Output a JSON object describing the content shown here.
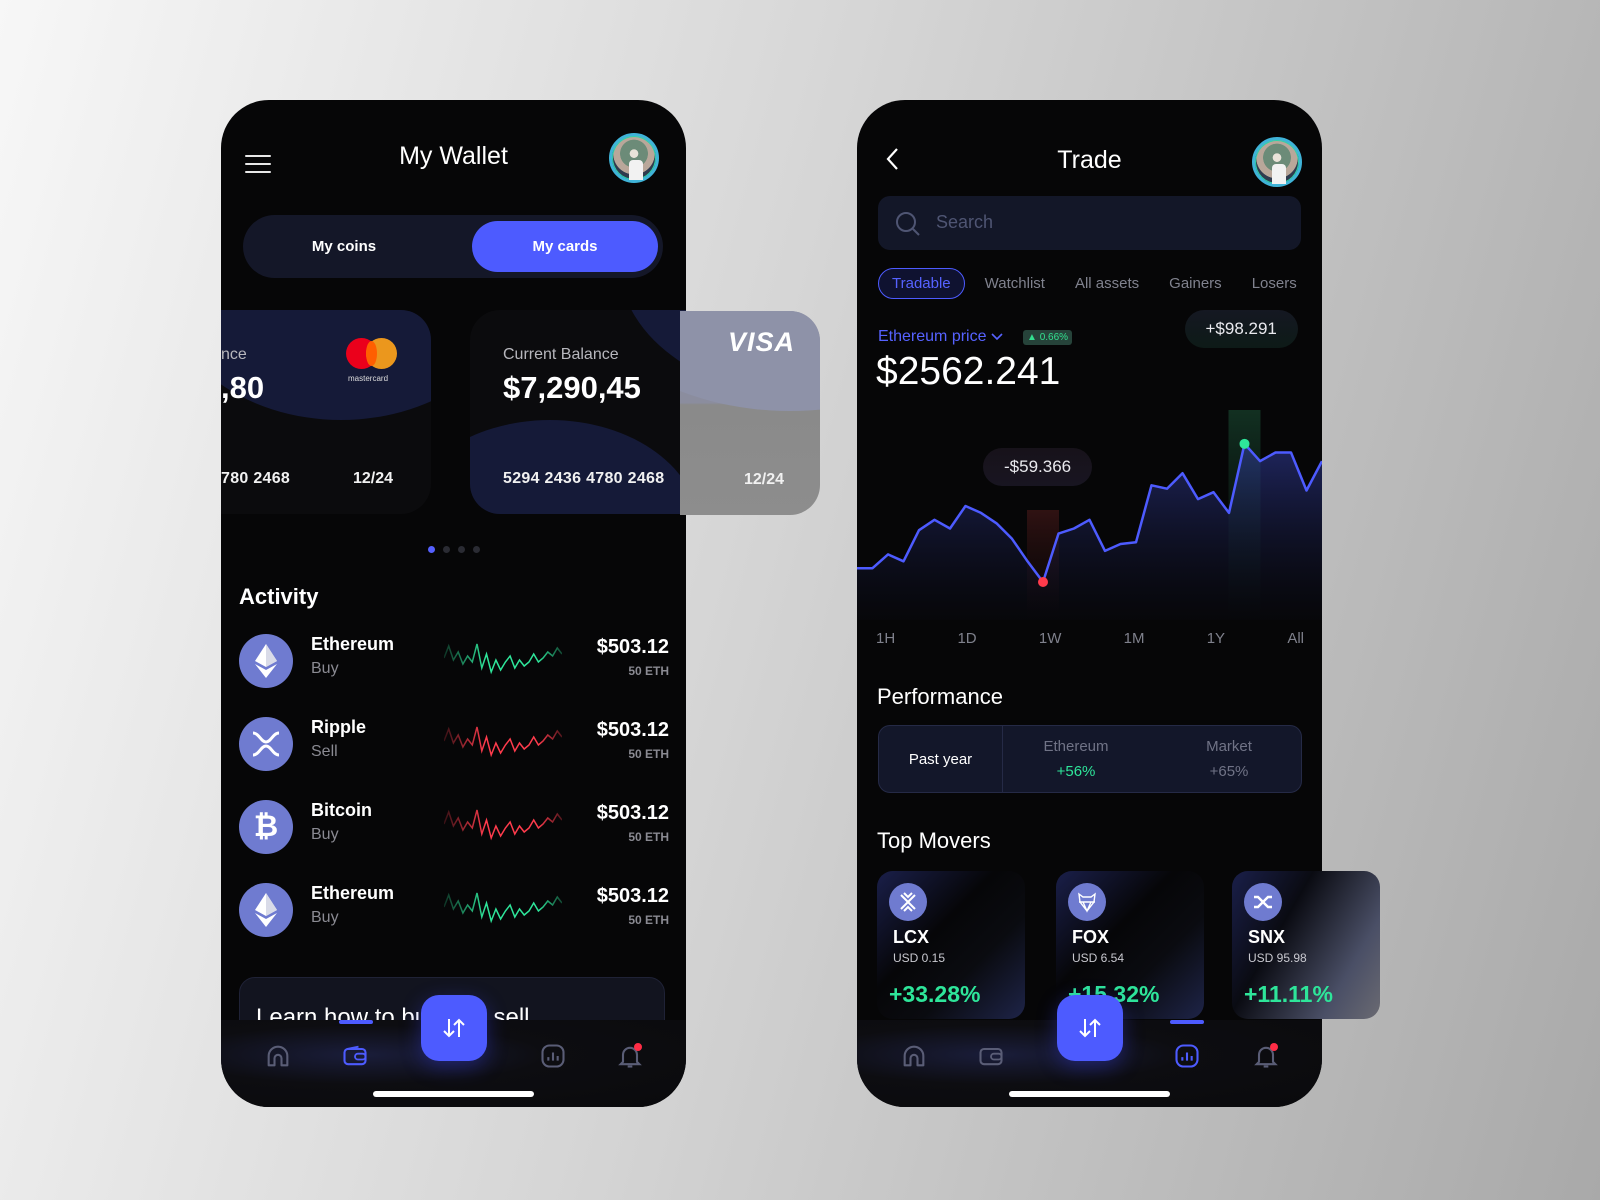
{
  "colors": {
    "accent": "#4d5bff",
    "positive": "#2ee59a",
    "negative": "#ff3b4c",
    "coin_icon_bg": "#6f7bd0"
  },
  "wallet": {
    "title": "My Wallet",
    "menu_icon": "hamburger-icon",
    "segments": [
      {
        "label": "My coins",
        "active": false
      },
      {
        "label": "My cards",
        "active": true
      }
    ],
    "cards": [
      {
        "brand": "mastercard",
        "brand_label": "mastercard",
        "label": "Current Balance",
        "label_visible": "nce",
        "balance_visible": ",80",
        "number_visible": "780 2468",
        "expiry": "12/24"
      },
      {
        "brand": "visa",
        "brand_label": "VISA",
        "label": "Current Balance",
        "balance": "$7,290,45",
        "number": "5294 2436 4780 2468",
        "expiry": "12/24"
      }
    ],
    "carousel": {
      "count": 4,
      "active_index": 0
    },
    "activity_title": "Activity",
    "activity": [
      {
        "coin": "Ethereum",
        "action": "Buy",
        "amount": "$503.12",
        "sub": "50 ETH",
        "trend": "up",
        "icon": "ethereum-icon"
      },
      {
        "coin": "Ripple",
        "action": "Sell",
        "amount": "$503.12",
        "sub": "50 ETH",
        "trend": "down",
        "icon": "ripple-icon"
      },
      {
        "coin": "Bitcoin",
        "action": "Buy",
        "amount": "$503.12",
        "sub": "50 ETH",
        "trend": "down",
        "icon": "bitcoin-icon"
      },
      {
        "coin": "Ethereum",
        "action": "Buy",
        "amount": "$503.12",
        "sub": "50 ETH",
        "trend": "up",
        "icon": "ethereum-icon"
      }
    ],
    "learn_banner": "Learn how to buy and sell",
    "tabbar": {
      "active": "wallet",
      "items": [
        "home",
        "wallet",
        "swap",
        "stats",
        "notifications"
      ]
    }
  },
  "trade": {
    "title": "Trade",
    "search_placeholder": "Search",
    "chips": [
      {
        "label": "Tradable",
        "active": true
      },
      {
        "label": "Watchlist",
        "active": false
      },
      {
        "label": "All assets",
        "active": false
      },
      {
        "label": "Gainers",
        "active": false
      },
      {
        "label": "Losers",
        "active": false
      }
    ],
    "asset_label": "Ethereum price",
    "change_badge": "0.66%",
    "price": "$2562.241",
    "tooltip_high": "+$98.291",
    "tooltip_low": "-$59.366",
    "ranges": [
      "1H",
      "1D",
      "1W",
      "1M",
      "1Y",
      "All"
    ],
    "performance_title": "Performance",
    "performance": {
      "period": "Past year",
      "ethereum_label": "Ethereum",
      "ethereum_value": "+56%",
      "market_label": "Market",
      "market_value": "+65%"
    },
    "top_movers_title": "Top Movers",
    "movers": [
      {
        "symbol": "LCX",
        "price": "USD 0.15",
        "change": "+33.28%",
        "icon": "lcx-icon"
      },
      {
        "symbol": "FOX",
        "price": "USD 6.54",
        "change": "+15.32%",
        "icon": "fox-icon"
      },
      {
        "symbol": "SNX",
        "price": "USD 95.98",
        "change": "+11.11%",
        "icon": "snx-icon"
      }
    ],
    "tabbar": {
      "active": "stats",
      "items": [
        "home",
        "wallet",
        "swap",
        "stats",
        "notifications"
      ]
    }
  },
  "chart_data": {
    "type": "area",
    "title": "Ethereum price",
    "series": [
      {
        "name": "Ethereum",
        "values": [
          30,
          30,
          38,
          34,
          52,
          58,
          53,
          66,
          62,
          56,
          47,
          34,
          22,
          50,
          53,
          58,
          40,
          44,
          45,
          78,
          76,
          85,
          70,
          74,
          62,
          102,
          92,
          97,
          97,
          75,
          92
        ]
      }
    ],
    "annotations": [
      {
        "label": "-$59.366",
        "index": 12,
        "kind": "low"
      },
      {
        "label": "+$98.291",
        "index": 25,
        "kind": "high"
      }
    ],
    "x_ticks": [
      "1H",
      "1D",
      "1W",
      "1M",
      "1Y",
      "All"
    ],
    "ylim": [
      0,
      110
    ],
    "grid": false
  }
}
